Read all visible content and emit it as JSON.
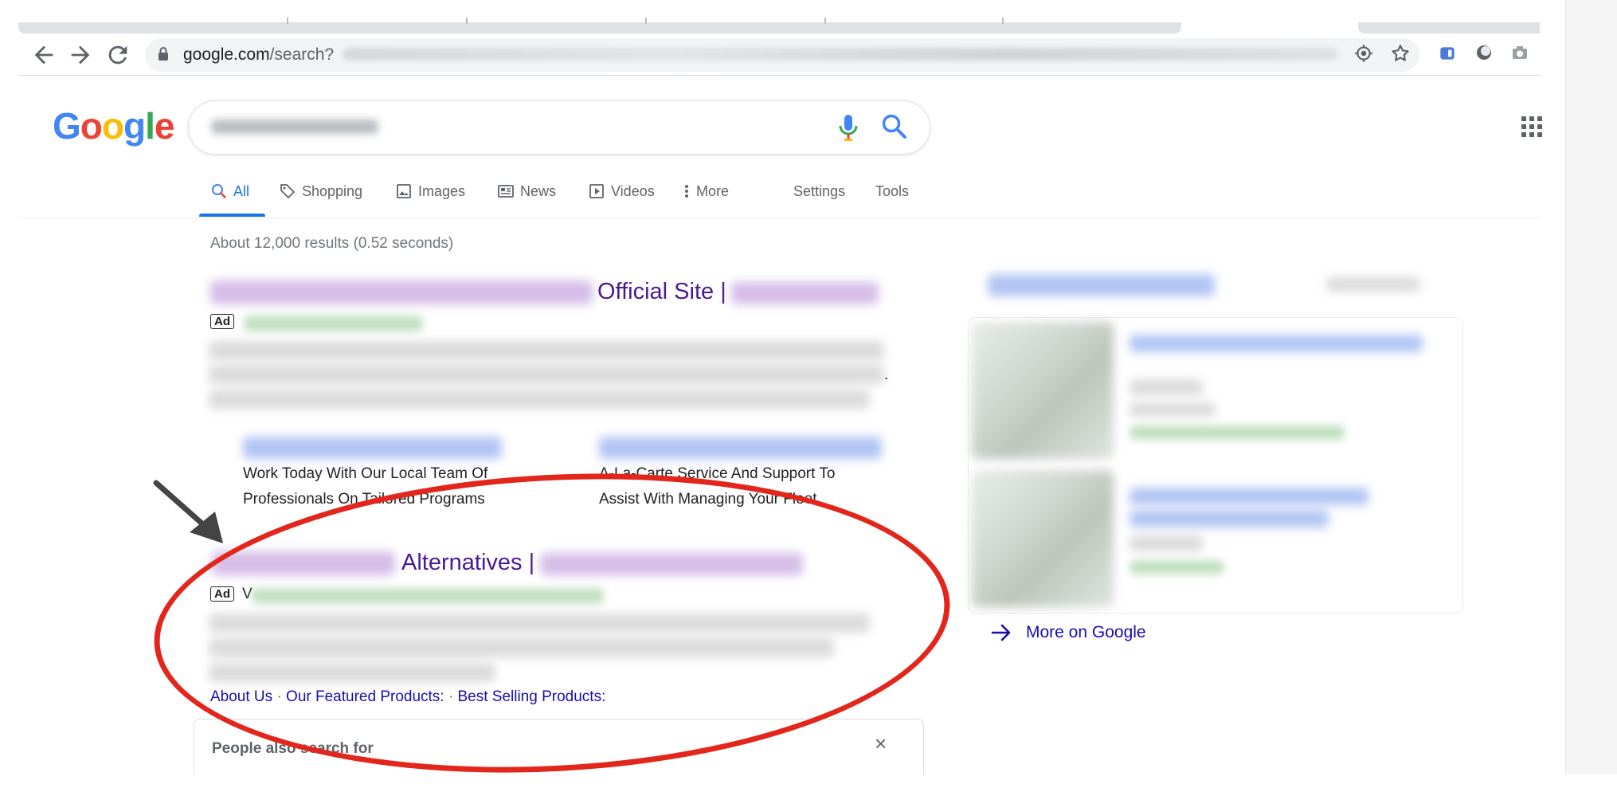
{
  "browser": {
    "url_domain": "google.com",
    "url_path": "/search?",
    "nav_back_icon": "arrow-left-icon",
    "nav_forward_icon": "arrow-right-icon",
    "nav_reload_icon": "reload-icon"
  },
  "google": {
    "logo": "Google",
    "tabs": [
      {
        "label": "All",
        "icon": "search-icon"
      },
      {
        "label": "Shopping",
        "icon": "tag-icon"
      },
      {
        "label": "Images",
        "icon": "image-icon"
      },
      {
        "label": "News",
        "icon": "news-icon"
      },
      {
        "label": "Videos",
        "icon": "play-icon"
      },
      {
        "label": "More",
        "icon": "more-vert-icon"
      }
    ],
    "settings_label": "Settings",
    "tools_label": "Tools",
    "stats": "About 12,000 results (0.52 seconds)"
  },
  "results": {
    "ad1": {
      "title_visible": "Official Site |",
      "badge": "Ad",
      "sitelinks": [
        {
          "desc_line1": "Work Today With Our Local Team Of",
          "desc_line2": "Professionals On Tailored Programs"
        },
        {
          "desc_line1": "A-La-Carte Service And Support To",
          "desc_line2": "Assist With Managing Your Fleet"
        }
      ],
      "trailing_period": "."
    },
    "ad2": {
      "title_visible": "Alternatives |",
      "badge": "Ad",
      "badge_trailing": "V",
      "links": [
        "About Us",
        "Our Featured Products:",
        "Best Selling Products:"
      ],
      "separator": "·"
    },
    "people_also_search": {
      "title": "People also search for",
      "close": "×"
    }
  },
  "shopping_panel": {
    "more_label": "More on Google"
  },
  "colors": {
    "link_blue": "#1a0dab",
    "visited_purple": "#4b1a91",
    "annotation_red": "#e3261c",
    "tab_active": "#1a73e8"
  }
}
